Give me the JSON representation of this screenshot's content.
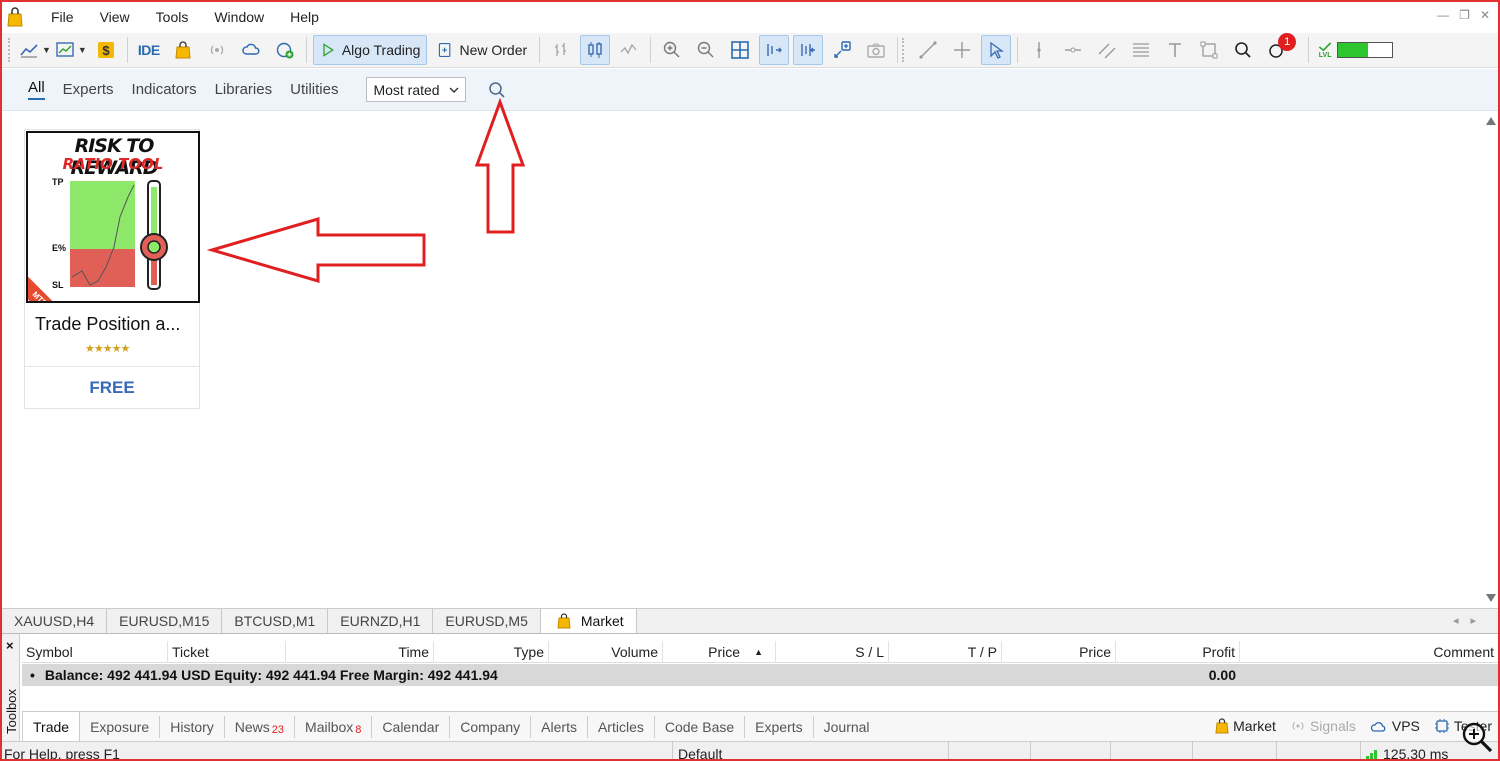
{
  "menubar": {
    "items": [
      "File",
      "View",
      "Tools",
      "Window",
      "Help"
    ]
  },
  "toolbar": {
    "ide_label": "IDE",
    "algo_trading_label": "Algo Trading",
    "new_order_label": "New Order",
    "notification_count": "1",
    "level_meter_fraction": 0.55,
    "level_label": "LVL"
  },
  "market": {
    "tabs": [
      "All",
      "Experts",
      "Indicators",
      "Libraries",
      "Utilities"
    ],
    "active_tab": "All",
    "sort": {
      "selected": "Most rated"
    }
  },
  "product": {
    "image_title_line1": "RISK TO REWARD",
    "image_title_line2": "RATIO TOOL",
    "image_label_tp": "TP",
    "image_label_e": "E%",
    "image_label_sl": "SL",
    "image_badge": "MT5",
    "name": "Trade Position a...",
    "rating_stars": "★★★★★",
    "rating_value": 5,
    "price": "FREE"
  },
  "chart_tabs": [
    "XAUUSD,H4",
    "EURUSD,M15",
    "BTCUSD,M1",
    "EURNZD,H1",
    "EURUSD,M5"
  ],
  "active_chart_tab": "Market",
  "toolbox": {
    "close_label": "×",
    "side_label": "Toolbox",
    "columns": [
      "Symbol",
      "Ticket",
      "Time",
      "Type",
      "Volume",
      "Price",
      "S / L",
      "T / P",
      "Price",
      "Profit",
      "Comment"
    ],
    "sort_indicator": "▲",
    "balance_bullet": "•",
    "balance_text": "Balance: 492 441.94 USD  Equity: 492 441.94  Free Margin: 492 441.94",
    "balance_profit": "0.00",
    "tabs": [
      {
        "label": "Trade",
        "count": ""
      },
      {
        "label": "Exposure",
        "count": ""
      },
      {
        "label": "History",
        "count": ""
      },
      {
        "label": "News",
        "count": "23"
      },
      {
        "label": "Mailbox",
        "count": "8"
      },
      {
        "label": "Calendar",
        "count": ""
      },
      {
        "label": "Company",
        "count": ""
      },
      {
        "label": "Alerts",
        "count": ""
      },
      {
        "label": "Articles",
        "count": ""
      },
      {
        "label": "Code Base",
        "count": ""
      },
      {
        "label": "Experts",
        "count": ""
      },
      {
        "label": "Journal",
        "count": ""
      }
    ],
    "right_links": [
      "Market",
      "Signals",
      "VPS",
      "Tester"
    ]
  },
  "statusbar": {
    "help": "For Help, press F1",
    "profile": "Default",
    "ping": "125.30 ms"
  },
  "colors": {
    "accent_blue": "#2a6ab2",
    "annotation_red": "#e02020",
    "price_blue": "#3a6ab8"
  }
}
